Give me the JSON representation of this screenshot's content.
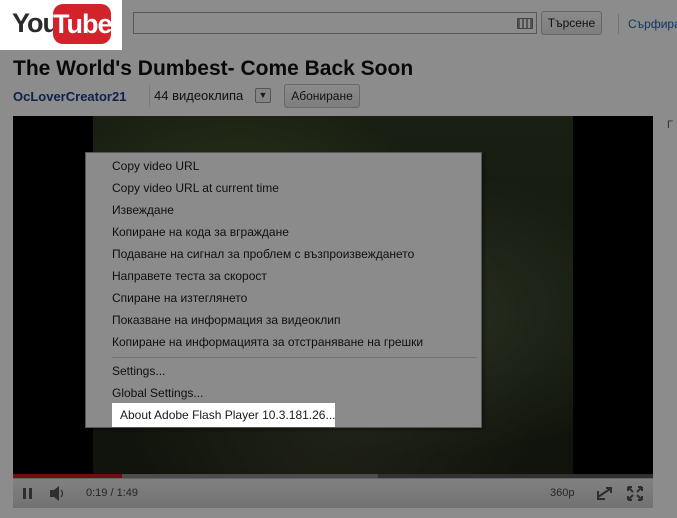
{
  "header": {
    "logo_you": "You",
    "logo_tube": "Tube",
    "search_button": "Търсене",
    "browse_link": "Сърфира"
  },
  "video": {
    "title": "The World's Dumbest- Come Back Soon",
    "channel": "OcLoverCreator21",
    "video_count": "44 видеоклипа",
    "subscribe": "Абониране"
  },
  "player": {
    "current_time": "0:19",
    "time_separator": "/",
    "duration": "1:49",
    "quality": "360p",
    "progress_fraction": 0.17,
    "loaded_fraction": 0.57
  },
  "context_menu": {
    "items": [
      "Copy video URL",
      "Copy video URL at current time",
      "Извеждане",
      "Копиране на кода за вграждане",
      "Подаване на сигнал за проблем с възпроизвеждането",
      "Направете теста за скорост",
      "Спиране на изтеглянето",
      "Показване на информация за видеоклип",
      "Копиране на информацията за отстраняване на грешки"
    ],
    "settings": "Settings...",
    "global_settings": "Global Settings...",
    "about": "About Adobe Flash Player 10.3.181.26..."
  },
  "colors": {
    "logo_red": "#d2222a",
    "link_blue": "#1c62b9",
    "progress_red": "#cc181e"
  },
  "icons": [
    "keyboard-icon",
    "chevron-down-icon",
    "pause-icon",
    "volume-icon",
    "popout-icon",
    "fullscreen-icon"
  ]
}
